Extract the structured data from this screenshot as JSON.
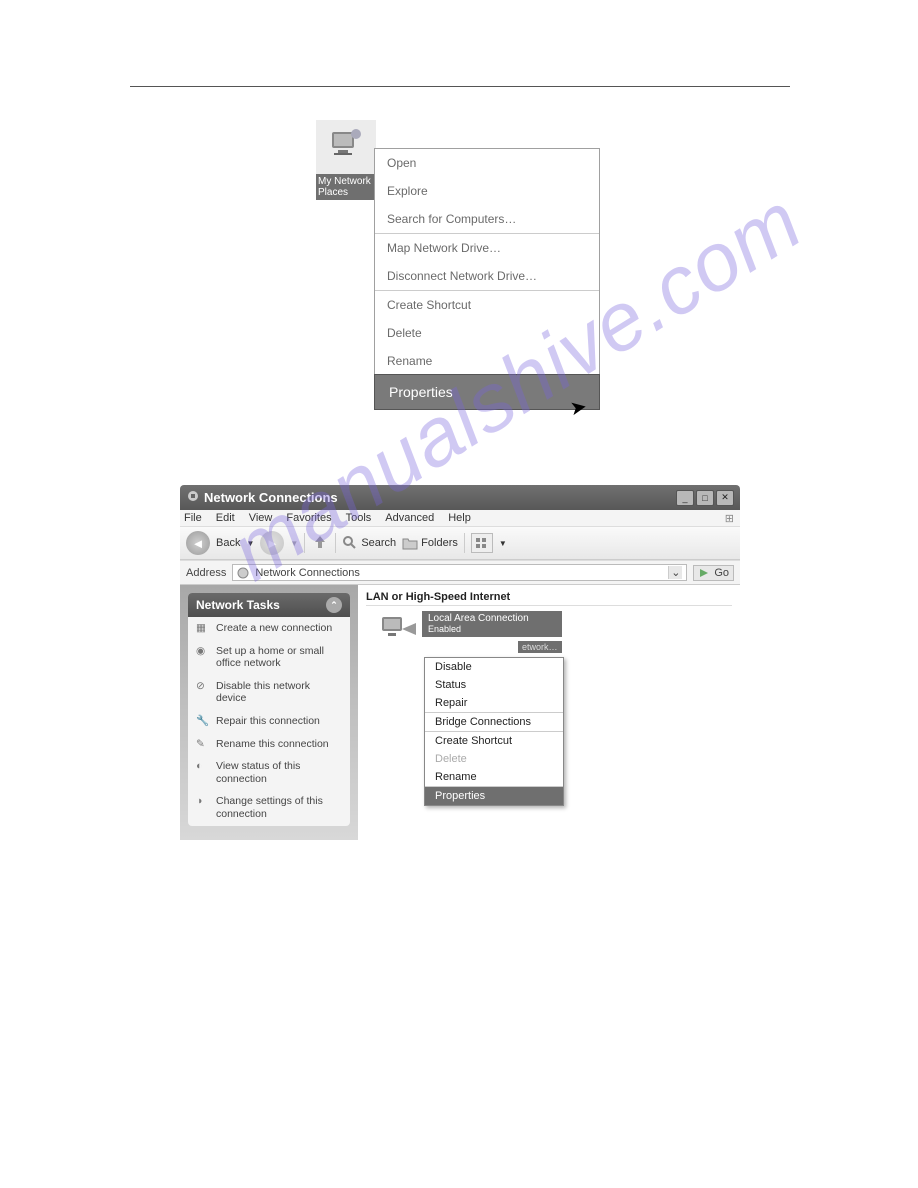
{
  "desktop_icon": {
    "label": "My Network Places"
  },
  "context_menu_1": {
    "group1": [
      "Open",
      "Explore",
      "Search for Computers…"
    ],
    "group2": [
      "Map Network Drive…",
      "Disconnect Network Drive…"
    ],
    "group3": [
      "Create Shortcut",
      "Delete",
      "Rename"
    ],
    "highlighted": "Properties"
  },
  "window": {
    "title": "Network Connections",
    "menus": [
      "File",
      "Edit",
      "View",
      "Favorites",
      "Tools",
      "Advanced",
      "Help"
    ],
    "toolbar": {
      "back": "Back",
      "search": "Search",
      "folders": "Folders"
    },
    "address": {
      "label": "Address",
      "value": "Network Connections",
      "go": "Go"
    },
    "sidebar": {
      "title": "Network Tasks",
      "tasks": [
        "Create a new connection",
        "Set up a home or small office network",
        "Disable this network device",
        "Repair this connection",
        "Rename this connection",
        "View status of this connection",
        "Change settings of this connection"
      ]
    },
    "main": {
      "section": "LAN or High-Speed Internet",
      "item": {
        "name": "Local Area Connection",
        "status": "Enabled",
        "sub": "etwork…"
      }
    }
  },
  "context_menu_2": {
    "group1": [
      "Disable",
      "Status",
      "Repair"
    ],
    "group2": [
      "Bridge Connections"
    ],
    "group3": [
      "Create Shortcut"
    ],
    "disabled": "Delete",
    "group3b": [
      "Rename"
    ],
    "highlighted": "Properties"
  },
  "watermark": "manualshive.com"
}
